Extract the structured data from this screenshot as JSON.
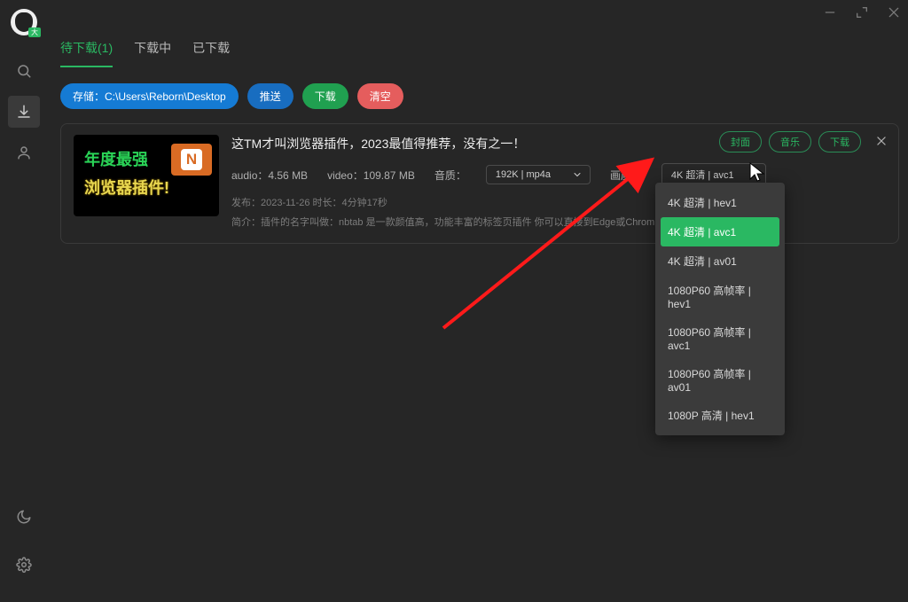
{
  "titlebar": {
    "minimize_hint": "最小化",
    "maximize_hint": "最大化",
    "close_hint": "关闭"
  },
  "avatar": {
    "badge": "大"
  },
  "sidebar": {
    "items": [
      {
        "name": "search-icon"
      },
      {
        "name": "download-icon"
      },
      {
        "name": "user-icon"
      }
    ],
    "bottom": [
      {
        "name": "moon-icon"
      },
      {
        "name": "gear-icon"
      }
    ]
  },
  "tabs": [
    {
      "label": "待下载",
      "count": "(1)",
      "active": true
    },
    {
      "label": "下载中",
      "active": false
    },
    {
      "label": "已下载",
      "active": false
    }
  ],
  "actions": {
    "storage_label": "存储：C:\\Users\\Reborn\\Desktop",
    "push_label": "推送",
    "download_label": "下载",
    "clear_label": "清空"
  },
  "video": {
    "title": "这TM才叫浏览器插件，2023最值得推荐，没有之一！",
    "thumb_line1": "年度最强",
    "thumb_line2": "浏览器插件!",
    "thumb_badge": "N",
    "audio_label": "audio：",
    "audio_size": "4.56 MB",
    "video_label": "video：",
    "video_size": "109.87 MB",
    "audio_quality_label": "音质：",
    "audio_quality_value": "192K | mp4a",
    "video_quality_label": "画质：",
    "video_quality_value": "4K 超清 | avc1",
    "publish": "发布：2023-11-26 时长：4分钟17秒",
    "desc": "简介：插件的名字叫做：nbtab 是一款颜值高，功能丰富的标签页插件 你可以直接到Edge或Chrom 插件           ttps...",
    "action_cover": "封面",
    "action_music": "音乐",
    "action_download": "下载"
  },
  "quality_dropdown": {
    "options": [
      "4K 超清 | hev1",
      "4K 超清 | avc1",
      "4K 超清 | av01",
      "1080P60 高帧率 | hev1",
      "1080P60 高帧率 | avc1",
      "1080P60 高帧率 | av01",
      "1080P 高清 | hev1"
    ],
    "selected_index": 1
  },
  "colors": {
    "accent": "#2ab862",
    "primary_blue": "#157bd4",
    "danger": "#e55d5d"
  }
}
